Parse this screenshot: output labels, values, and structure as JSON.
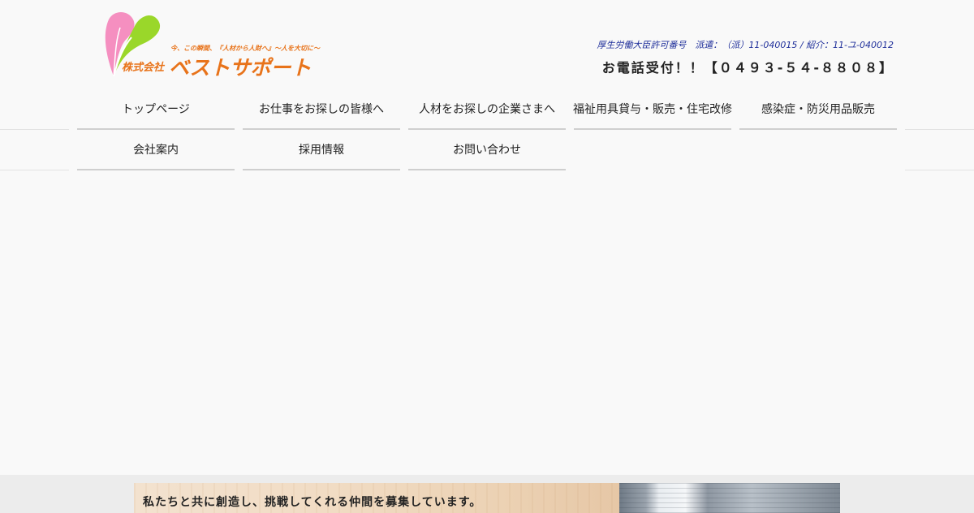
{
  "header": {
    "logo": {
      "tagline": "今、この瞬間、『人材から人財へ』～人を大切に～",
      "company_prefix": "株式会社",
      "brand": "ベストサポート"
    },
    "license": "厚生労働大臣許可番号　派遣：（派）11-040015 / 紹介：11-ユ-040012",
    "phone": "お電話受付！！【０４９３-５４-８８０８】"
  },
  "nav": {
    "items": [
      {
        "label": "トップページ"
      },
      {
        "label": "お仕事をお探しの皆様へ"
      },
      {
        "label": "人材をお探しの企業さまへ"
      },
      {
        "label": "福祉用具貸与・販売・住宅改修"
      },
      {
        "label": "感染症・防災用品販売"
      },
      {
        "label": "会社案内"
      },
      {
        "label": "採用情報"
      },
      {
        "label": "お問い合わせ"
      }
    ]
  },
  "banner": {
    "text": "私たちと共に創造し、挑戦してくれる仲間を募集しています。"
  },
  "colors": {
    "brand_orange": "#e8731a",
    "license_blue": "#1f2f9a",
    "heart_pink": "#f58fc0",
    "heart_green": "#9ad72a"
  }
}
